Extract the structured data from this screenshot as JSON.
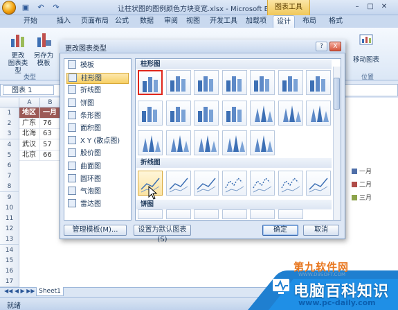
{
  "window": {
    "title": "让柱状图的图例颜色方块变宽.xlsx - Microsoft Ex...",
    "chart_tools": "图表工具"
  },
  "qat": {
    "save": "save-icon",
    "undo": "undo-icon",
    "redo": "redo-icon"
  },
  "tabs": [
    "开始",
    "插入",
    "页面布局",
    "公式",
    "数据",
    "审阅",
    "视图",
    "开发工具",
    "加载项",
    "设计",
    "布局",
    "格式"
  ],
  "ribbon": {
    "change_type": "更改\n图表类型",
    "save_template": "另存为\n模板",
    "group_type": "类型",
    "move_chart": "移动图表",
    "group_location": "位置"
  },
  "namebox": "图表 1",
  "sheet": {
    "columns": [
      "A",
      "B"
    ],
    "rows": [
      "1",
      "2",
      "3",
      "4",
      "5",
      "6",
      "7",
      "8",
      "9",
      "10",
      "11",
      "12",
      "13",
      "14",
      "15",
      "16",
      "17"
    ],
    "cells": [
      [
        "地区",
        "一月"
      ],
      [
        "广东",
        "76"
      ],
      [
        "北海",
        "63"
      ],
      [
        "武汉",
        "57"
      ],
      [
        "北京",
        "66"
      ]
    ],
    "legend": [
      {
        "label": "一月",
        "color": "#4f6fa8"
      },
      {
        "label": "二月",
        "color": "#b04c48"
      },
      {
        "label": "三月",
        "color": "#8ca34a"
      }
    ],
    "tab": "Sheet1"
  },
  "status": "就绪",
  "dialog": {
    "title": "更改图表类型",
    "help": "?",
    "close": "X",
    "categories": [
      "模板",
      "柱形图",
      "折线图",
      "饼图",
      "条形图",
      "面积图",
      "X Y (散点图)",
      "股价图",
      "曲面图",
      "圆环图",
      "气泡图",
      "雷达图"
    ],
    "selected_category": "柱形图",
    "section_column": "柱形图",
    "section_line": "折线图",
    "section_pie": "饼图",
    "manage_templates": "管理模板(M)...",
    "set_default": "设置为默认图表(S)",
    "ok": "确定",
    "cancel": "取消"
  },
  "watermark": {
    "top": "第九软件网",
    "url": "WWW.D9SOFT.COM",
    "name": "电脑百科知识",
    "site": "www.pc-daily.com"
  }
}
